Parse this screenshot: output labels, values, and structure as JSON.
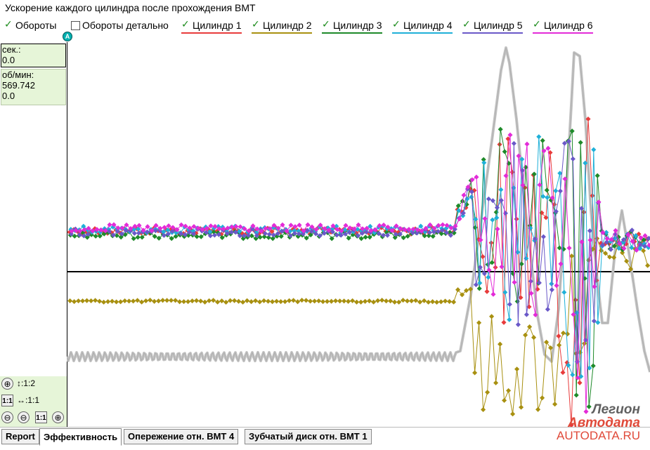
{
  "title": "Ускорение каждого цилиндра после прохождения ВМТ",
  "legend": [
    {
      "label": "Обороты",
      "checked": true,
      "color": ""
    },
    {
      "label": "Обороты детально",
      "checked": false,
      "color": ""
    },
    {
      "label": "Цилиндр 1",
      "checked": true,
      "color": "#e83b3b"
    },
    {
      "label": "Цилиндр 2",
      "checked": true,
      "color": "#a89010"
    },
    {
      "label": "Цилиндр 3",
      "checked": true,
      "color": "#1e8a2a"
    },
    {
      "label": "Цилиндр 4",
      "checked": true,
      "color": "#1fb0d8"
    },
    {
      "label": "Цилиндр 5",
      "checked": true,
      "color": "#6a58c8"
    },
    {
      "label": "Цилиндр 6",
      "checked": true,
      "color": "#e32bd8"
    }
  ],
  "marker": "A",
  "info": {
    "sec_label": "сек.:",
    "sec_value": "0.0",
    "rpm_label": "об/мин:",
    "rpm_value": "569.742",
    "rpm_value2": "0.0"
  },
  "zoom": {
    "v_label": "↕:1:2",
    "h_label": "↔:1:1",
    "btn_plus": "⊕",
    "btn_minus": "⊖",
    "btn_11": "1:1"
  },
  "tabs": [
    "Report",
    "Эффективность",
    "Опережение отн. ВМТ 4",
    "Зубчатый диск отн. ВМТ 1"
  ],
  "active_tab": 1,
  "watermark": {
    "line1": "Легион",
    "line2": "Автодата",
    "url": "AUTODATA.RU"
  },
  "chart_data": {
    "type": "line",
    "title": "Ускорение каждого цилиндра после прохождения ВМТ",
    "xlabel": "",
    "ylabel": "",
    "grid": false,
    "notes_axis": "no tick labels shown; zero line horizontal",
    "series": [
      {
        "name": "Обороты",
        "color": "#c4c4c4",
        "points": [
          [
            0,
            0.78
          ],
          [
            550,
            0.78
          ],
          [
            570,
            0.7
          ],
          [
            610,
            0.2
          ],
          [
            625,
            0.02
          ],
          [
            640,
            0.05
          ],
          [
            660,
            0.5
          ],
          [
            690,
            0.95
          ],
          [
            700,
            1.0
          ],
          [
            715,
            0.6
          ],
          [
            725,
            0.1
          ],
          [
            740,
            0.05
          ],
          [
            760,
            0.5
          ],
          [
            780,
            1.0
          ],
          [
            800,
            0.4
          ],
          [
            820,
            0.85
          ],
          [
            830,
            1.0
          ]
        ]
      },
      {
        "name": "Цилиндр 1",
        "color": "#e83b3b"
      },
      {
        "name": "Цилиндр 2",
        "color": "#a89010"
      },
      {
        "name": "Цилиндр 3",
        "color": "#1e8a2a"
      },
      {
        "name": "Цилиндр 4",
        "color": "#1fb0d8"
      },
      {
        "name": "Цилиндр 5",
        "color": "#6a58c8"
      },
      {
        "name": "Цилиндр 6",
        "color": "#e32bd8"
      }
    ],
    "levels": {
      "steady_cyl_1_3_4_5_6": 0.27,
      "steady_cyl_2": -0.2,
      "zero_line": 0
    }
  }
}
